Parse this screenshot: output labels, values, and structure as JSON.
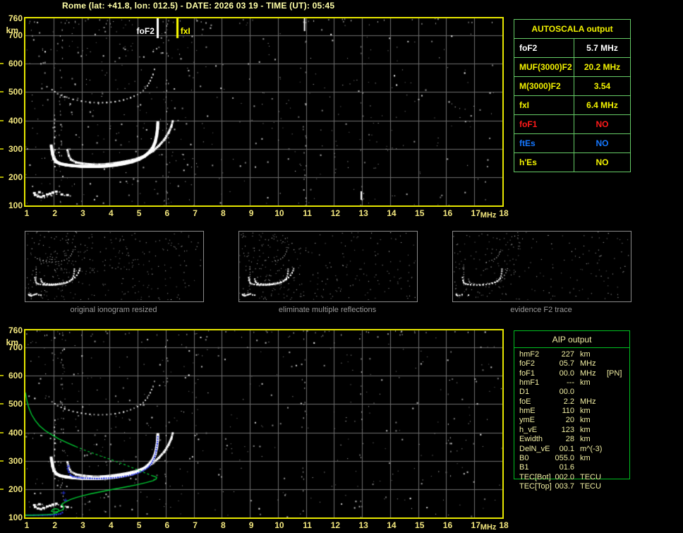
{
  "title": "Rome (lat: +41.8, lon: 012.5) - DATE: 2026 03 19 - TIME (UT): 05:45",
  "colors": {
    "background": "#000000",
    "title_text": "#ffffa8",
    "axis_text": "#f2e67e",
    "plot_border": "#e6e600",
    "grid": "#6e6e6e",
    "autoscala_border": "#66cc66",
    "autoscala_yellow": "#f2f200",
    "autoscala_white": "#ffffff",
    "autoscala_red": "#ff1a1a",
    "autoscala_blue": "#1577ff",
    "aip_border": "#00c020",
    "aip_text": "#f0eda2",
    "caption_gray": "#9a9a9a",
    "profile_green": "#00c832",
    "restored_blue": "#2635e0"
  },
  "autoscala": {
    "header": "AUTOSCALA output",
    "rows": [
      {
        "label": "foF2",
        "value": "5.7 MHz",
        "color": "#ffffff"
      },
      {
        "label": "MUF(3000)F2",
        "value": "20.2 MHz",
        "color": "#f2f200"
      },
      {
        "label": "M(3000)F2",
        "value": "3.54",
        "color": "#f2f200"
      },
      {
        "label": "fxI",
        "value": "6.4 MHz",
        "color": "#f2f200"
      },
      {
        "label": "foF1",
        "value": "NO",
        "color": "#ff1a1a"
      },
      {
        "label": "ftEs",
        "value": "NO",
        "color": "#1577ff"
      },
      {
        "label": "h'Es",
        "value": "NO",
        "color": "#f2f200"
      }
    ]
  },
  "aip": {
    "header": "AIP output",
    "rows": [
      {
        "label": "hmF2",
        "value": "227",
        "unit": "km",
        "note": ""
      },
      {
        "label": "foF2",
        "value": "05.7",
        "unit": "MHz",
        "note": ""
      },
      {
        "label": "foF1",
        "value": "00.0",
        "unit": "MHz",
        "note": "[PN]"
      },
      {
        "label": "hmF1",
        "value": "---",
        "unit": "km",
        "note": ""
      },
      {
        "label": "D1",
        "value": "00.0",
        "unit": "",
        "note": ""
      },
      {
        "label": "foE",
        "value": "2.2",
        "unit": "MHz",
        "note": ""
      },
      {
        "label": "hmE",
        "value": "110",
        "unit": "km",
        "note": ""
      },
      {
        "label": "ymE",
        "value": "20",
        "unit": "km",
        "note": ""
      },
      {
        "label": "h_vE",
        "value": "123",
        "unit": "km",
        "note": ""
      },
      {
        "label": "Ewidth",
        "value": "28",
        "unit": "km",
        "note": ""
      },
      {
        "label": "DelN_vE",
        "value": "00.1",
        "unit": "m^(-3)",
        "note": ""
      },
      {
        "label": "B0",
        "value": "055.0",
        "unit": "km",
        "note": ""
      },
      {
        "label": "B1",
        "value": "01.6",
        "unit": "",
        "note": ""
      },
      {
        "label": "TEC[Bot]",
        "value": "002.0",
        "unit": "TECU",
        "note": ""
      },
      {
        "label": "TEC[Top]",
        "value": "003.7",
        "unit": "TECU",
        "note": ""
      }
    ]
  },
  "thumbnails": [
    {
      "caption": "original ionogram resized",
      "content": "all traces + noise"
    },
    {
      "caption": "eliminate multiple reflections",
      "content": "traces, multiple-hop echo mostly removed"
    },
    {
      "caption": "evidence F2 trace",
      "content": "sparse F2 trace evidence"
    }
  ],
  "chart_data": [
    {
      "type": "scatter",
      "name": "scaled ionogram",
      "xlabel": "MHz",
      "ylabel": "km",
      "xlim": [
        1,
        18
      ],
      "ylim": [
        100,
        760
      ],
      "xticks": [
        1,
        2,
        3,
        4,
        5,
        6,
        7,
        8,
        9,
        10,
        11,
        12,
        13,
        14,
        15,
        16,
        17,
        18
      ],
      "yticks": [
        760,
        700,
        600,
        500,
        400,
        300,
        200,
        100
      ],
      "grid": true,
      "legend": "none",
      "markers": [
        {
          "label": "foF2",
          "x_mhz": 5.7,
          "color": "#ffffff"
        },
        {
          "label": "fxI",
          "x_mhz": 6.4,
          "color": "#ffff00"
        }
      ],
      "series": [
        {
          "name": "F2-ordinary-trace",
          "color": "#ffffff",
          "points": [
            [
              1.92,
              310
            ],
            [
              1.97,
              282
            ],
            [
              2.02,
              265
            ],
            [
              2.1,
              254
            ],
            [
              2.25,
              247
            ],
            [
              2.45,
              243
            ],
            [
              2.7,
              240
            ],
            [
              3.0,
              238
            ],
            [
              3.3,
              237
            ],
            [
              3.6,
              237
            ],
            [
              3.9,
              239
            ],
            [
              4.2,
              242
            ],
            [
              4.5,
              247
            ],
            [
              4.8,
              254
            ],
            [
              5.05,
              263
            ],
            [
              5.25,
              274
            ],
            [
              5.42,
              288
            ],
            [
              5.55,
              305
            ],
            [
              5.63,
              325
            ],
            [
              5.68,
              348
            ],
            [
              5.71,
              372
            ],
            [
              5.72,
              392
            ]
          ]
        },
        {
          "name": "F2-extraordinary-trace",
          "color": "#ffffff",
          "points": [
            [
              2.5,
              295
            ],
            [
              2.55,
              275
            ],
            [
              2.62,
              262
            ],
            [
              2.8,
              252
            ],
            [
              3.1,
              247
            ],
            [
              3.5,
              244
            ],
            [
              3.9,
              246
            ],
            [
              4.3,
              251
            ],
            [
              4.7,
              258
            ],
            [
              5.0,
              266
            ],
            [
              5.3,
              278
            ],
            [
              5.55,
              292
            ],
            [
              5.75,
              310
            ],
            [
              5.95,
              332
            ],
            [
              6.1,
              356
            ],
            [
              6.2,
              378
            ],
            [
              6.25,
              397
            ]
          ]
        },
        {
          "name": "second-hop-echo",
          "color": "#bbbbbb",
          "points": [
            [
              1.95,
              508
            ],
            [
              2.15,
              494
            ],
            [
              2.4,
              483
            ],
            [
              2.7,
              474
            ],
            [
              3.0,
              468
            ],
            [
              3.3,
              464
            ],
            [
              3.6,
              462
            ],
            [
              3.9,
              463
            ],
            [
              4.2,
              466
            ],
            [
              4.5,
              472
            ],
            [
              4.75,
              480
            ],
            [
              5.0,
              491
            ],
            [
              5.2,
              505
            ],
            [
              5.35,
              522
            ],
            [
              5.45,
              540
            ],
            [
              5.55,
              562
            ],
            [
              5.6,
              580
            ]
          ]
        },
        {
          "name": "E-layer-remnant",
          "color": "#ffffff",
          "points": [
            [
              1.35,
              138
            ],
            [
              1.45,
              133
            ],
            [
              1.55,
              131
            ],
            [
              1.65,
              135
            ],
            [
              1.78,
              140
            ],
            [
              1.88,
              143
            ],
            [
              1.98,
              147
            ],
            [
              2.1,
              150
            ],
            [
              1.5,
              148
            ],
            [
              1.32,
              145
            ],
            [
              2.3,
              140
            ],
            [
              2.5,
              138
            ]
          ]
        },
        {
          "name": "vertical-artifact-2MHz",
          "color": "#dddddd",
          "points": [
            [
              2.03,
              418
            ],
            [
              2.04,
              403
            ],
            [
              2.03,
              390
            ],
            [
              2.05,
              362
            ],
            [
              2.04,
              340
            ],
            [
              2.03,
              318
            ],
            [
              2.05,
              296
            ],
            [
              2.04,
              272
            ],
            [
              2.03,
              252
            ],
            [
              2.05,
              237
            ]
          ]
        }
      ]
    },
    {
      "type": "scatter",
      "name": "AIP electron density profile and restored trace",
      "xlabel": "MHz",
      "ylabel": "km",
      "xlim": [
        1,
        18
      ],
      "ylim": [
        100,
        760
      ],
      "xticks": [
        1,
        2,
        3,
        4,
        5,
        6,
        7,
        8,
        9,
        10,
        11,
        12,
        13,
        14,
        15,
        16,
        17,
        18
      ],
      "yticks": [
        760,
        700,
        600,
        500,
        400,
        300,
        200,
        100
      ],
      "grid": true,
      "background_series": "same white ionogram traces as chart 0",
      "series": [
        {
          "name": "restored-F2-trace-blue",
          "color": "#2635e0",
          "points": [
            [
              2.5,
              272
            ],
            [
              2.55,
              260
            ],
            [
              2.6,
              250
            ],
            [
              2.7,
              244
            ],
            [
              2.85,
              241
            ],
            [
              3.05,
              239
            ],
            [
              3.3,
              238
            ],
            [
              3.55,
              237
            ],
            [
              3.8,
              238
            ],
            [
              4.05,
              239
            ],
            [
              4.3,
              241
            ],
            [
              4.55,
              245
            ],
            [
              4.8,
              250
            ],
            [
              5.0,
              256
            ],
            [
              5.2,
              265
            ],
            [
              5.38,
              277
            ],
            [
              5.5,
              292
            ],
            [
              5.6,
              312
            ],
            [
              5.66,
              335
            ],
            [
              5.7,
              360
            ],
            [
              5.72,
              385
            ]
          ]
        },
        {
          "name": "restored-E-trace-blue",
          "color": "#2635e0",
          "points": [
            [
              1.0,
              108
            ],
            [
              1.3,
              108
            ],
            [
              1.6,
              108
            ],
            [
              1.9,
              109
            ],
            [
              2.1,
              110
            ],
            [
              2.25,
              113
            ],
            [
              2.32,
              117
            ]
          ]
        },
        {
          "name": "isolated-blue-points",
          "color": "#2635e0",
          "points": [
            [
              2.35,
              188
            ],
            [
              2.42,
              162
            ],
            [
              2.52,
              282
            ]
          ]
        },
        {
          "name": "profile-top-solid",
          "color": "#00c832",
          "points": [
            [
              1.0,
              541
            ],
            [
              1.05,
              512
            ],
            [
              1.12,
              487
            ],
            [
              1.22,
              463
            ],
            [
              1.35,
              442
            ],
            [
              1.5,
              424
            ],
            [
              1.7,
              407
            ],
            [
              1.95,
              391
            ],
            [
              2.2,
              377
            ],
            [
              2.5,
              363
            ],
            [
              2.8,
              350
            ]
          ]
        },
        {
          "name": "profile-mid-dashed",
          "color": "#00c832",
          "points": [
            [
              2.8,
              350
            ],
            [
              3.1,
              338
            ],
            [
              3.4,
              327
            ],
            [
              3.7,
              316
            ],
            [
              4.0,
              306
            ],
            [
              4.3,
              295
            ],
            [
              4.6,
              284
            ],
            [
              4.9,
              272
            ],
            [
              5.15,
              262
            ],
            [
              5.35,
              254
            ],
            [
              5.5,
              248
            ]
          ]
        },
        {
          "name": "profile-nose-and-valley-solid",
          "color": "#00c832",
          "points": [
            [
              5.5,
              248
            ],
            [
              5.62,
              244
            ],
            [
              5.68,
              241
            ],
            [
              5.66,
              236
            ],
            [
              5.55,
              230
            ],
            [
              5.3,
              223
            ],
            [
              4.95,
              215
            ],
            [
              4.55,
              207
            ],
            [
              4.1,
              199
            ],
            [
              3.7,
              191
            ],
            [
              3.35,
              184
            ],
            [
              3.05,
              177
            ],
            [
              2.8,
              170
            ],
            [
              2.6,
              163
            ],
            [
              2.45,
              156
            ],
            [
              2.33,
              149
            ],
            [
              2.28,
              145
            ],
            [
              2.35,
              140
            ],
            [
              2.37,
              133
            ],
            [
              2.3,
              126
            ],
            [
              2.15,
              121
            ],
            [
              2.0,
              119
            ],
            [
              1.93,
              122
            ],
            [
              1.97,
              128
            ],
            [
              2.07,
              131
            ],
            [
              2.17,
              129
            ],
            [
              2.2,
              124
            ],
            [
              2.13,
              117
            ],
            [
              1.98,
              112
            ],
            [
              1.78,
              110
            ],
            [
              1.52,
              109
            ],
            [
              1.25,
              108
            ],
            [
              1.0,
              108
            ]
          ]
        }
      ]
    }
  ]
}
